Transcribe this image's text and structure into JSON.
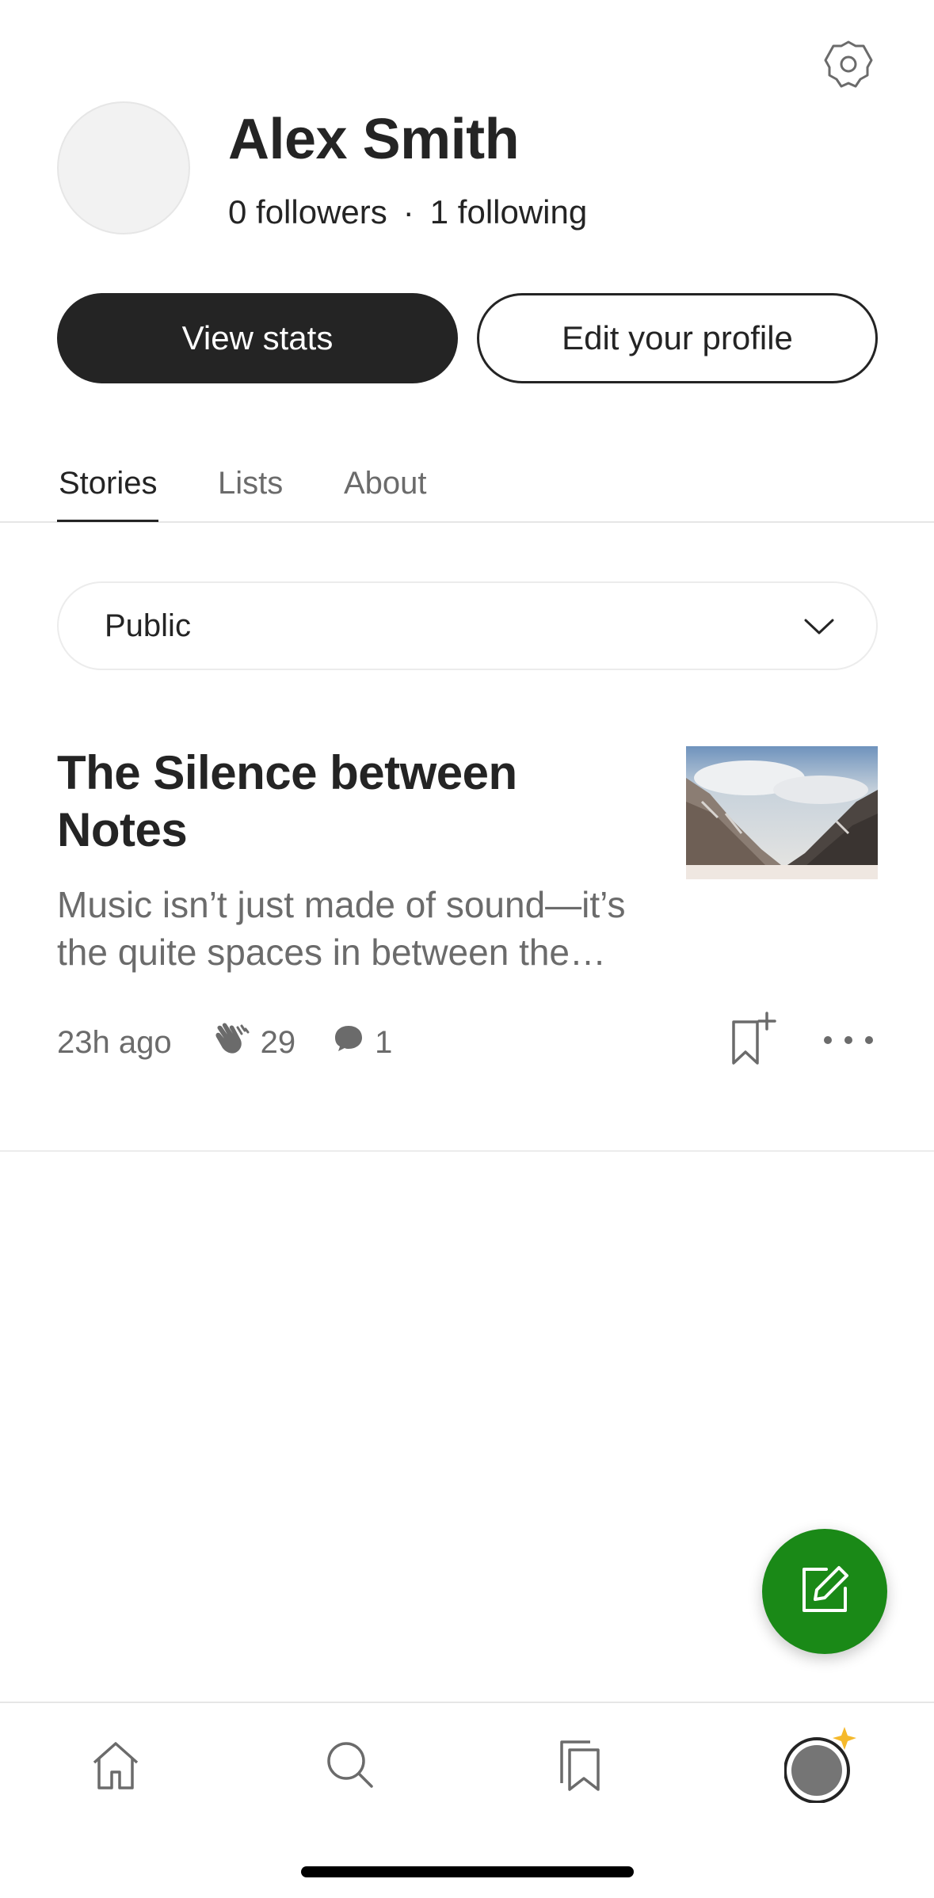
{
  "profile": {
    "name": "Alex Smith",
    "followers": "0 followers",
    "separator": "·",
    "following": "1 following"
  },
  "actions": {
    "view_stats": "View stats",
    "edit_profile": "Edit your profile"
  },
  "tabs": [
    {
      "label": "Stories",
      "active": true
    },
    {
      "label": "Lists",
      "active": false
    },
    {
      "label": "About",
      "active": false
    }
  ],
  "filter": {
    "selected": "Public"
  },
  "story": {
    "title": "The Silence between Notes",
    "subtitle": "Music isn’t just made of sound—it’s the quite spaces in between the notes that give it meaning.",
    "time_ago": "23h ago",
    "claps": "29",
    "responses": "1"
  },
  "icons": {
    "settings": "gear-icon",
    "chevron": "chevron-down-icon",
    "clap": "clap-icon",
    "response": "speech-bubble-icon",
    "bookmark": "bookmark-add-icon",
    "more": "more-horizontal-icon",
    "compose": "compose-icon",
    "nav_home": "home-icon",
    "nav_search": "search-icon",
    "nav_library": "library-icon",
    "nav_profile": "avatar-icon"
  },
  "colors": {
    "primary_text": "#242424",
    "secondary_text": "#6b6b6b",
    "fab_green": "#1a8917",
    "badge_star": "#f5b92b"
  }
}
